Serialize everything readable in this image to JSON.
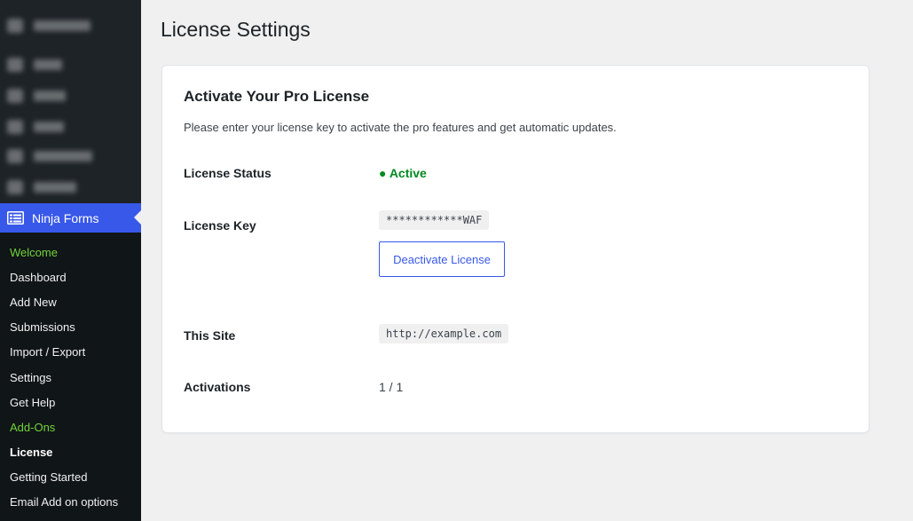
{
  "sidebar": {
    "active_menu": {
      "label": "Ninja Forms",
      "icon": "ninja-forms-icon"
    },
    "submenu": [
      {
        "label": "Welcome",
        "style": "green"
      },
      {
        "label": "Dashboard",
        "style": "normal"
      },
      {
        "label": "Add New",
        "style": "normal"
      },
      {
        "label": "Submissions",
        "style": "normal"
      },
      {
        "label": "Import / Export",
        "style": "normal"
      },
      {
        "label": "Settings",
        "style": "normal"
      },
      {
        "label": "Get Help",
        "style": "normal"
      },
      {
        "label": "Add-Ons",
        "style": "green"
      },
      {
        "label": "License",
        "style": "current"
      },
      {
        "label": "Getting Started",
        "style": "normal"
      },
      {
        "label": "Email Add on options",
        "style": "normal"
      }
    ]
  },
  "page": {
    "title": "License Settings"
  },
  "card": {
    "title": "Activate Your Pro License",
    "description": "Please enter your license key to activate the pro features and get automatic updates.",
    "status": {
      "label": "License Status",
      "value": "● Active",
      "color": "#008a20"
    },
    "key": {
      "label": "License Key",
      "value": "************WAF",
      "button": "Deactivate License"
    },
    "site": {
      "label": "This Site",
      "value": "http://example.com"
    },
    "activations": {
      "label": "Activations",
      "value": "1 / 1"
    }
  },
  "colors": {
    "accent": "#3858e9",
    "sidebar_bg": "#1d2327",
    "submenu_bg": "#101517",
    "green": "#72d33b"
  }
}
